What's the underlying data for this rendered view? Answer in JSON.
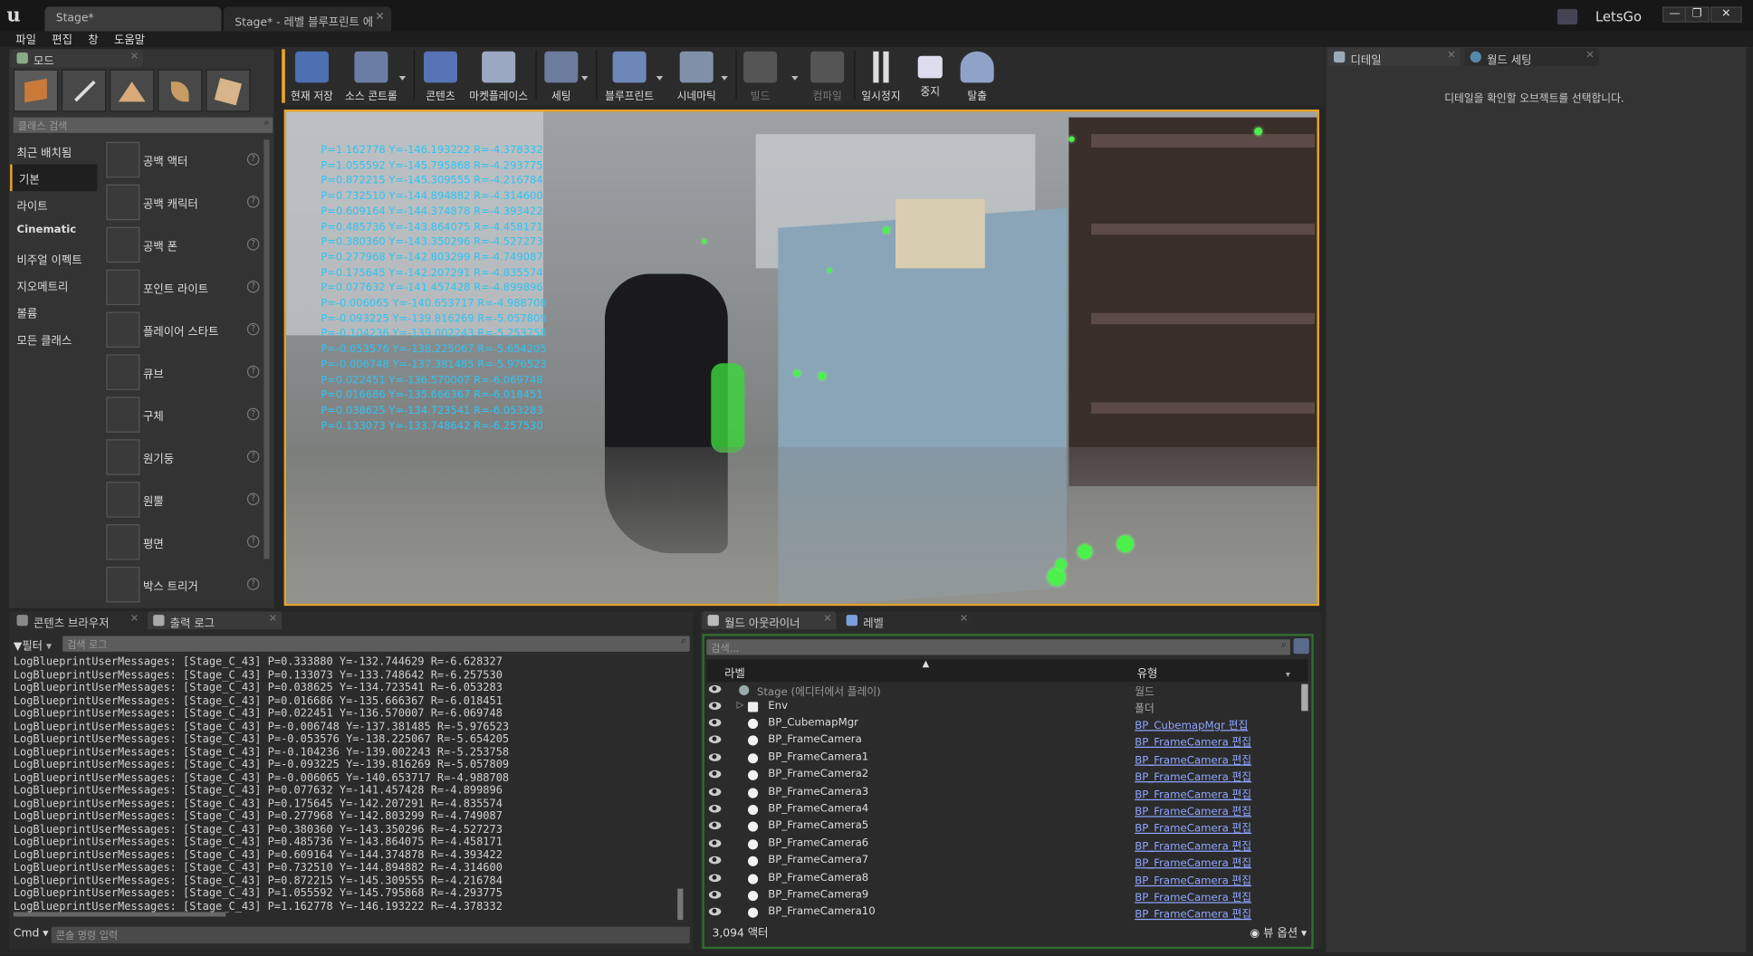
{
  "window": {
    "tabs": [
      {
        "label": "Stage*"
      },
      {
        "label": "Stage* - 레벨 블루프린트 에"
      }
    ],
    "user": "LetsGo",
    "controls": [
      "—",
      "❐",
      "✕"
    ]
  },
  "menu": [
    "파일",
    "편집",
    "창",
    "도움말"
  ],
  "modes": {
    "tab": "모드",
    "search_placeholder": "클래스 검색",
    "categories": [
      "최근 배치됨",
      "기본",
      "라이트",
      "Cinematic",
      "비주얼 이펙트",
      "지오메트리",
      "볼륨",
      "모든 클래스"
    ],
    "items": [
      "공백 액터",
      "공백 캐릭터",
      "공백 폰",
      "포인트 라이트",
      "플레이어 스타트",
      "큐브",
      "구체",
      "원기둥",
      "원뿔",
      "평면",
      "박스 트리거"
    ]
  },
  "toolbar": [
    "현재 저장",
    "소스 콘트롤",
    "콘텐츠",
    "마켓플레이스",
    "세팅",
    "블루프린트",
    "시네마틱",
    "빌드",
    "컴파일",
    "일시정지",
    "중지",
    "탈출"
  ],
  "viewport": {
    "overlay": [
      "P=1.162778 Y=-146.193222 R=-4.378332",
      "P=1.055592 Y=-145.795868 R=-4.293775",
      "P=0.872215 Y=-145.309555 R=-4.216784",
      "P=0.732510 Y=-144.894882 R=-4.314600",
      "P=0.609164 Y=-144.374878 R=-4.393422",
      "P=0.485736 Y=-143.864075 R=-4.458171",
      "P=0.380360 Y=-143.350296 R=-4.527273",
      "P=0.277968 Y=-142.803299 R=-4.749087",
      "P=0.175645 Y=-142.207291 R=-4.835574",
      "P=0.077632 Y=-141.457428 R=-4.899896",
      "P=-0.006065 Y=-140.653717 R=-4.988708",
      "P=-0.093225 Y=-139.816269 R=-5.057809",
      "P=-0.104236 Y=-139.002243 R=-5.253758",
      "P=-0.053576 Y=-138.225067 R=-5.654205",
      "P=-0.006748 Y=-137.381485 R=-5.976523",
      "P=0.022451 Y=-136.570007 R=-6.069748",
      "P=0.016686 Y=-135.666367 R=-6.018451",
      "P=0.038625 Y=-134.723541 R=-6.053283",
      "P=0.133073 Y=-133.748642 R=-6.257530"
    ]
  },
  "details": {
    "tabs": [
      "디테일",
      "월드 세팅"
    ],
    "empty": "디테일을 확인할 오브젝트를 선택합니다."
  },
  "bottom_left": {
    "tabs": [
      "콘텐츠 브라우저",
      "출력 로그"
    ],
    "filter": "필터",
    "search_placeholder": "검색 로그",
    "cmd": "Cmd",
    "cmd_placeholder": "콘솔 명령 입력",
    "lines": [
      "LogBlueprintUserMessages: [Stage_C_43] P=0.333880 Y=-132.744629 R=-6.628327",
      "LogBlueprintUserMessages: [Stage_C_43] P=0.133073 Y=-133.748642 R=-6.257530",
      "LogBlueprintUserMessages: [Stage_C_43] P=0.038625 Y=-134.723541 R=-6.053283",
      "LogBlueprintUserMessages: [Stage_C_43] P=0.016686 Y=-135.666367 R=-6.018451",
      "LogBlueprintUserMessages: [Stage_C_43] P=0.022451 Y=-136.570007 R=-6.069748",
      "LogBlueprintUserMessages: [Stage_C_43] P=-0.006748 Y=-137.381485 R=-5.976523",
      "LogBlueprintUserMessages: [Stage_C_43] P=-0.053576 Y=-138.225067 R=-5.654205",
      "LogBlueprintUserMessages: [Stage_C_43] P=-0.104236 Y=-139.002243 R=-5.253758",
      "LogBlueprintUserMessages: [Stage_C_43] P=-0.093225 Y=-139.816269 R=-5.057809",
      "LogBlueprintUserMessages: [Stage_C_43] P=-0.006065 Y=-140.653717 R=-4.988708",
      "LogBlueprintUserMessages: [Stage_C_43] P=0.077632 Y=-141.457428 R=-4.899896",
      "LogBlueprintUserMessages: [Stage_C_43] P=0.175645 Y=-142.207291 R=-4.835574",
      "LogBlueprintUserMessages: [Stage_C_43] P=0.277968 Y=-142.803299 R=-4.749087",
      "LogBlueprintUserMessages: [Stage_C_43] P=0.380360 Y=-143.350296 R=-4.527273",
      "LogBlueprintUserMessages: [Stage_C_43] P=0.485736 Y=-143.864075 R=-4.458171",
      "LogBlueprintUserMessages: [Stage_C_43] P=0.609164 Y=-144.374878 R=-4.393422",
      "LogBlueprintUserMessages: [Stage_C_43] P=0.732510 Y=-144.894882 R=-4.314600",
      "LogBlueprintUserMessages: [Stage_C_43] P=0.872215 Y=-145.309555 R=-4.216784",
      "LogBlueprintUserMessages: [Stage_C_43] P=1.055592 Y=-145.795868 R=-4.293775",
      "LogBlueprintUserMessages: [Stage_C_43] P=1.162778 Y=-146.193222 R=-4.378332"
    ]
  },
  "outliner": {
    "tabs": [
      "월드 아웃라이너",
      "레벨"
    ],
    "search_placeholder": "검색...",
    "col_label": "라벨",
    "col_type": "유형",
    "count": "3,094 액터",
    "view_options": "뷰 옵션",
    "rows": [
      {
        "name": "Stage (에디터에서 플레이)",
        "type": "월드"
      },
      {
        "name": "Env",
        "type": "폴더"
      },
      {
        "name": "BP_CubemapMgr",
        "type": "BP_CubemapMgr 편집"
      },
      {
        "name": "BP_FrameCamera",
        "type": "BP_FrameCamera 편집"
      },
      {
        "name": "BP_FrameCamera1",
        "type": "BP_FrameCamera 편집"
      },
      {
        "name": "BP_FrameCamera2",
        "type": "BP_FrameCamera 편집"
      },
      {
        "name": "BP_FrameCamera3",
        "type": "BP_FrameCamera 편집"
      },
      {
        "name": "BP_FrameCamera4",
        "type": "BP_FrameCamera 편집"
      },
      {
        "name": "BP_FrameCamera5",
        "type": "BP_FrameCamera 편집"
      },
      {
        "name": "BP_FrameCamera6",
        "type": "BP_FrameCamera 편집"
      },
      {
        "name": "BP_FrameCamera7",
        "type": "BP_FrameCamera 편집"
      },
      {
        "name": "BP_FrameCamera8",
        "type": "BP_FrameCamera 편집"
      },
      {
        "name": "BP_FrameCamera9",
        "type": "BP_FrameCamera 편집"
      },
      {
        "name": "BP_FrameCamera10",
        "type": "BP_FrameCamera 편집"
      }
    ]
  }
}
